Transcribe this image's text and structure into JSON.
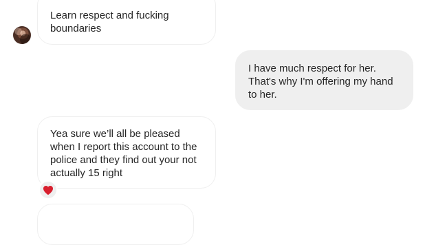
{
  "conversation": {
    "messages": [
      {
        "direction": "incoming",
        "text": "Learn respect and fucking boundaries"
      },
      {
        "direction": "outgoing",
        "text": "I have much respect for her. That's why I'm offering my hand to her."
      },
      {
        "direction": "incoming",
        "text": "Yea sure we’ll all be pleased when I report this account to the police and they find out your not actually 15 right",
        "reaction": "heart-icon"
      },
      {
        "direction": "incoming",
        "text": ""
      }
    ]
  },
  "colors": {
    "incoming_bubble_bg": "#ffffff",
    "incoming_bubble_border": "#efefef",
    "outgoing_bubble_bg": "#efefef",
    "text": "#262626",
    "reaction_heart": "#d81f2e"
  }
}
